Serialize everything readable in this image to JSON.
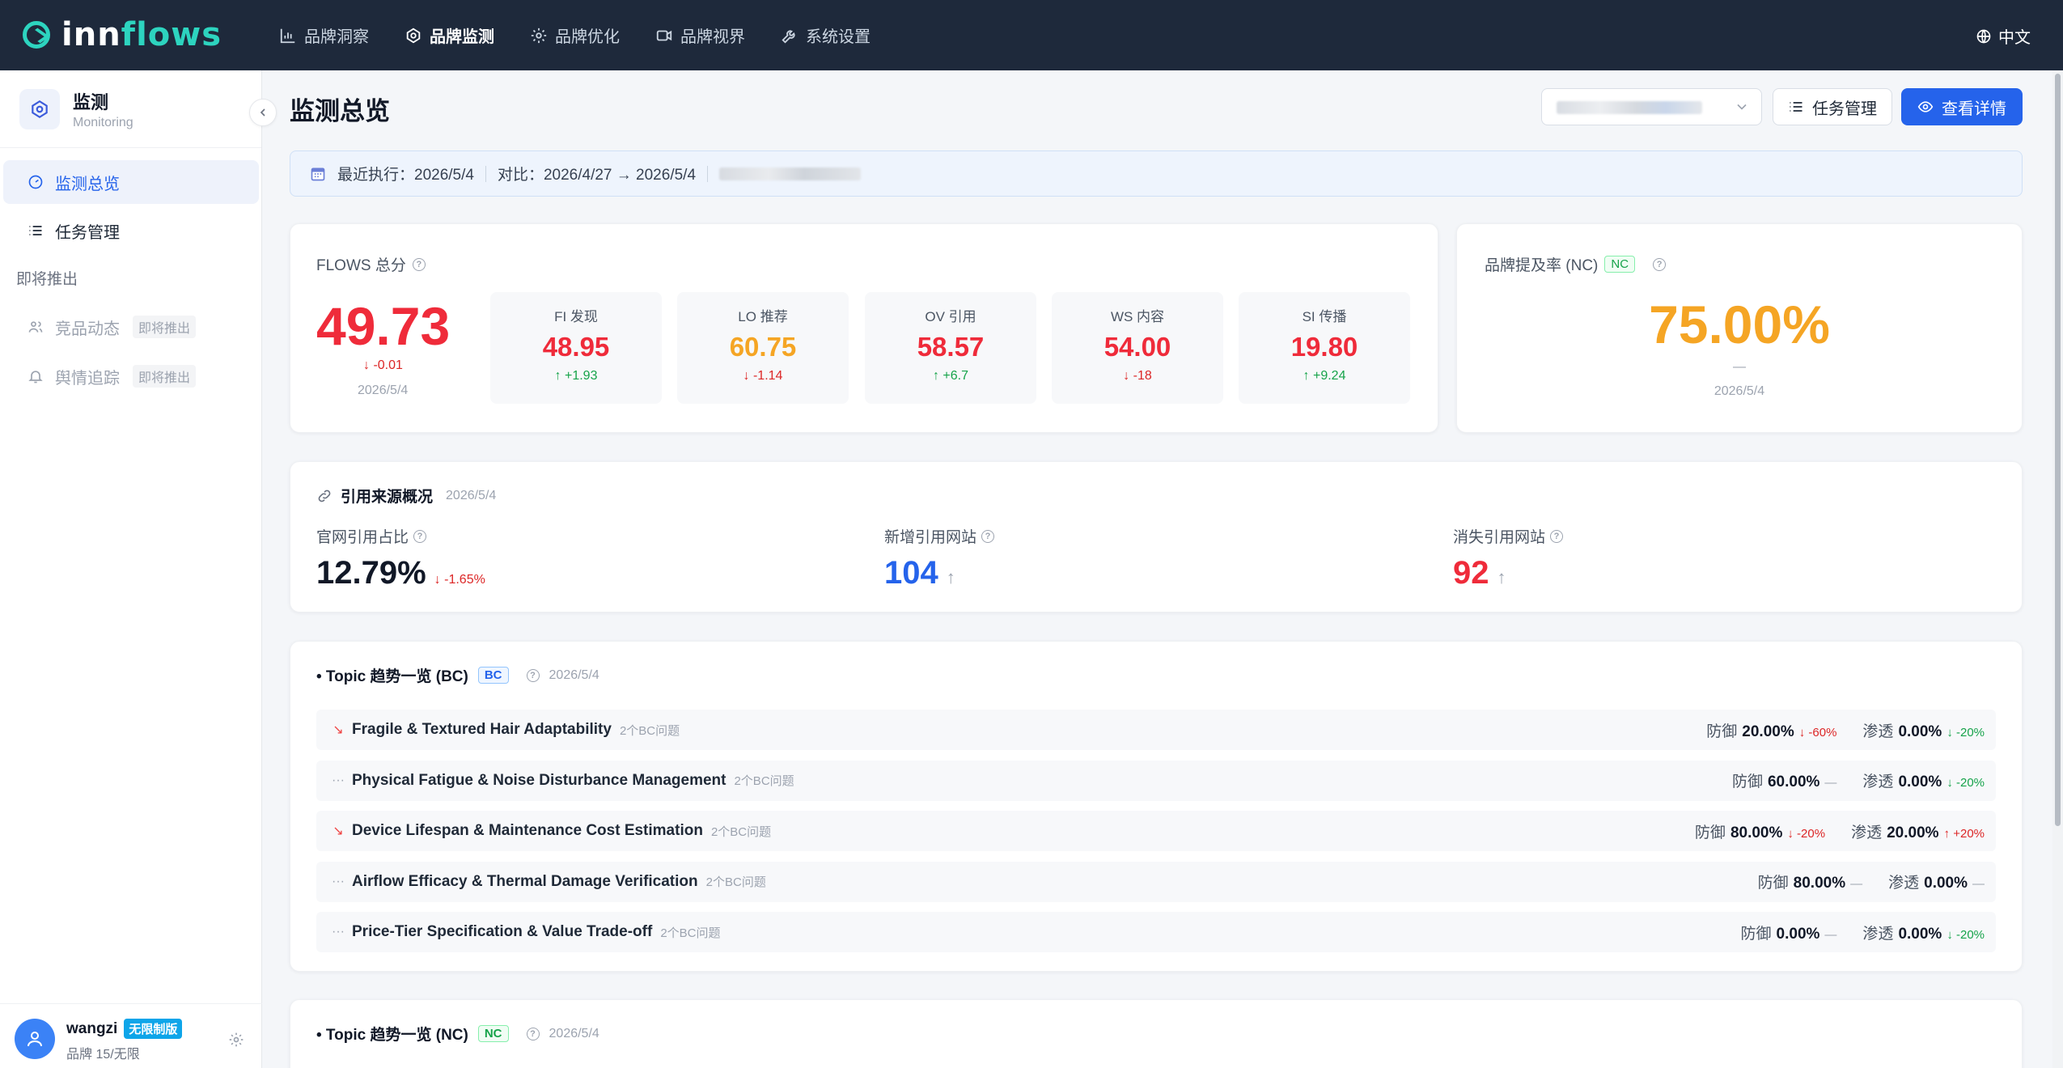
{
  "app": {
    "logo_prefix": "inn",
    "logo_suffix": "flows",
    "language": "中文"
  },
  "nav": [
    {
      "label": "品牌洞察",
      "icon": "bar-chart-icon"
    },
    {
      "label": "品牌监测",
      "icon": "monitor-icon",
      "active": true
    },
    {
      "label": "品牌优化",
      "icon": "gear-icon"
    },
    {
      "label": "品牌视界",
      "icon": "video-icon"
    },
    {
      "label": "系统设置",
      "icon": "wrench-icon"
    }
  ],
  "sidebar": {
    "title": "监测",
    "subtitle": "Monitoring",
    "items": [
      {
        "label": "监测总览",
        "active": true
      },
      {
        "label": "任务管理"
      }
    ],
    "section_label": "即将推出",
    "coming": [
      {
        "label": "竞品动态",
        "tag": "即将推出"
      },
      {
        "label": "舆情追踪",
        "tag": "即将推出"
      }
    ],
    "user": {
      "name": "wangzi",
      "plan": "无限制版",
      "quota": "品牌 15/无限"
    }
  },
  "header": {
    "title": "监测总览",
    "task_button": "任务管理",
    "detail_button": "查看详情"
  },
  "info_bar": {
    "last_run": "最近执行：2026/5/4",
    "compare": "对比：2026/4/27 → 2026/5/4"
  },
  "flows": {
    "label": "FLOWS 总分",
    "score": "49.73",
    "delta": "↓ -0.01",
    "date": "2026/5/4",
    "metrics": [
      {
        "label": "FI 发现",
        "value": "48.95",
        "delta": "↑ +1.93",
        "trend": "up",
        "color": "red"
      },
      {
        "label": "LO 推荐",
        "value": "60.75",
        "delta": "↓ -1.14",
        "trend": "down",
        "color": "orange"
      },
      {
        "label": "OV 引用",
        "value": "58.57",
        "delta": "↑ +6.7",
        "trend": "up",
        "color": "red"
      },
      {
        "label": "WS 内容",
        "value": "54.00",
        "delta": "↓ -18",
        "trend": "down",
        "color": "red"
      },
      {
        "label": "SI 传播",
        "value": "19.80",
        "delta": "↑ +9.24",
        "trend": "up",
        "color": "red"
      }
    ]
  },
  "mention_rate": {
    "label": "品牌提及率 (NC)",
    "tag": "NC",
    "value": "75.00%",
    "dash": "—",
    "date": "2026/5/4"
  },
  "citations": {
    "title": "引用来源概况",
    "date": "2026/5/4",
    "official_label": "官网引用占比",
    "official_value": "12.79%",
    "official_delta": "↓ -1.65%",
    "new_label": "新增引用网站",
    "new_value": "104",
    "new_arrow": "↑",
    "lost_label": "消失引用网站",
    "lost_value": "92",
    "lost_arrow": "↑"
  },
  "topics_bc": {
    "title": "• Topic 趋势一览 (BC)",
    "tag": "BC",
    "date": "2026/5/4",
    "defense_label": "防御",
    "penetration_label": "渗透",
    "rows": [
      {
        "icon": "↘",
        "trend": true,
        "name": "Fragile & Textured Hair Adaptability",
        "count": "2个BC问题",
        "defense": "20.00%",
        "defense_delta": "↓ -60%",
        "defense_dir": "down",
        "pen": "0.00%",
        "pen_delta": "↓ -20%",
        "pen_dir": "up"
      },
      {
        "icon": "···",
        "trend": false,
        "name": "Physical Fatigue & Noise Disturbance Management",
        "count": "2个BC问题",
        "defense": "60.00%",
        "defense_delta": "—",
        "defense_dir": "none",
        "pen": "0.00%",
        "pen_delta": "↓ -20%",
        "pen_dir": "up"
      },
      {
        "icon": "↘",
        "trend": true,
        "name": "Device Lifespan & Maintenance Cost Estimation",
        "count": "2个BC问题",
        "defense": "80.00%",
        "defense_delta": "↓ -20%",
        "defense_dir": "down",
        "pen": "20.00%",
        "pen_delta": "↑ +20%",
        "pen_dir": "down"
      },
      {
        "icon": "···",
        "trend": false,
        "name": "Airflow Efficacy & Thermal Damage Verification",
        "count": "2个BC问题",
        "defense": "80.00%",
        "defense_delta": "—",
        "defense_dir": "none",
        "pen": "0.00%",
        "pen_delta": "—",
        "pen_dir": "none"
      },
      {
        "icon": "···",
        "trend": false,
        "name": "Price-Tier Specification & Value Trade-off",
        "count": "2个BC问题",
        "defense": "0.00%",
        "defense_delta": "—",
        "defense_dir": "none",
        "pen": "0.00%",
        "pen_delta": "↓ -20%",
        "pen_dir": "up"
      }
    ]
  },
  "topics_nc": {
    "title": "• Topic 趋势一览 (NC)",
    "tag": "NC",
    "date": "2026/5/4"
  }
}
